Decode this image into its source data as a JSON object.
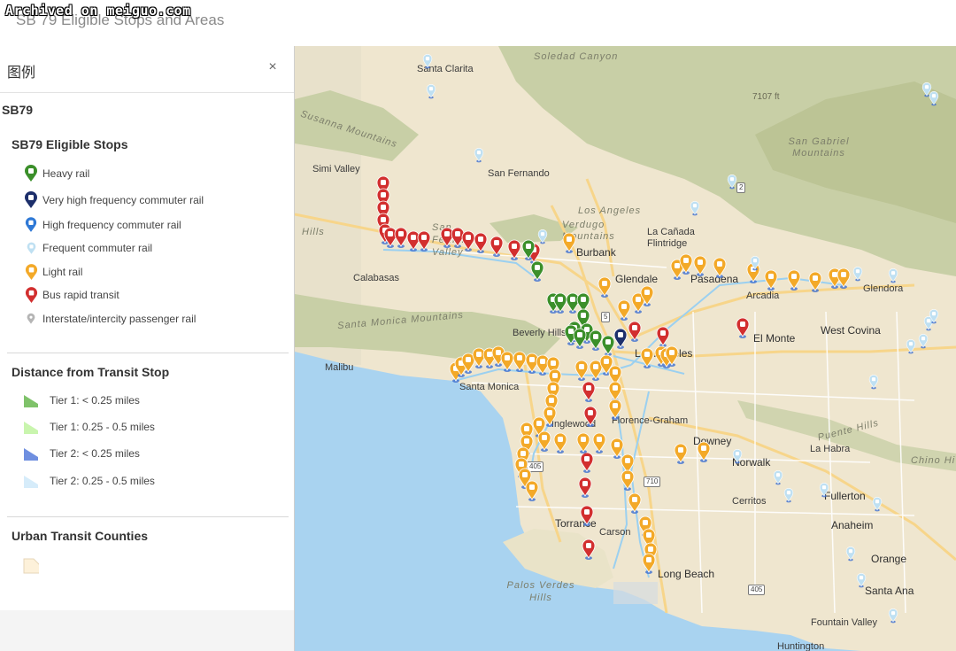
{
  "watermark": "Archived on meiguo.com",
  "app": {
    "title": "SB 79 Eligible Stops and Areas"
  },
  "legend": {
    "title": "图例",
    "close_label": "×",
    "layer_name": "SB79",
    "groups": [
      {
        "title": "SB79 Eligible Stops",
        "items": [
          {
            "label": "Heavy rail",
            "color": "#3b8f2a",
            "icon": "train-icon"
          },
          {
            "label": "Very high frequency commuter rail",
            "color": "#1d2f6b",
            "icon": "train-icon"
          },
          {
            "label": "High frequency commuter rail",
            "color": "#2f79d6",
            "icon": "train-icon"
          },
          {
            "label": "Frequent commuter rail",
            "color": "#bfe0f2",
            "icon": "train-icon"
          },
          {
            "label": "Light rail",
            "color": "#f3a928",
            "icon": "tram-icon"
          },
          {
            "label": "Bus rapid transit",
            "color": "#d22f2f",
            "icon": "bus-icon"
          },
          {
            "label": "Interstate/intercity passenger rail",
            "color": "#b5b5b5",
            "icon": "pin-icon"
          }
        ]
      },
      {
        "title": "Distance from Transit Stop",
        "items": [
          {
            "label": "Tier 1: < 0.25 miles",
            "color": "#7fc26a"
          },
          {
            "label": "Tier 1: 0.25 - 0.5 miles",
            "color": "#c9f5ae"
          },
          {
            "label": "Tier 2: < 0.25 miles",
            "color": "#6f8fe0"
          },
          {
            "label": "Tier 2: 0.25 - 0.5 miles",
            "color": "#d6ecfa"
          }
        ]
      },
      {
        "title": "Urban Transit Counties",
        "items": [
          {
            "label": "",
            "color": "#fdf1da"
          }
        ]
      }
    ]
  },
  "map": {
    "colors": {
      "ocean": "#a9d3f0",
      "land": "#efe6cf",
      "mountain": "#c8cfa6",
      "road": "#ffffff",
      "highway": "#f7d58a"
    },
    "places": [
      {
        "name": "Santa Clarita",
        "kind": "city"
      },
      {
        "name": "Soledad Canyon",
        "kind": "terrain"
      },
      {
        "name": "Susanna Mountains",
        "kind": "terrain"
      },
      {
        "name": "Simi Valley",
        "kind": "city"
      },
      {
        "name": "San Fernando",
        "kind": "city"
      },
      {
        "name": "San Gabriel Mountains",
        "kind": "terrain"
      },
      {
        "name": "Los Angeles",
        "kind": "terrain"
      },
      {
        "name": "San Fernando Valley",
        "kind": "terrain"
      },
      {
        "name": "Verdugo Mountains",
        "kind": "terrain"
      },
      {
        "name": "La Cañada Flintridge",
        "kind": "city"
      },
      {
        "name": "Hills",
        "kind": "terrain"
      },
      {
        "name": "Burbank",
        "kind": "city"
      },
      {
        "name": "Glendale",
        "kind": "city"
      },
      {
        "name": "Pasadena",
        "kind": "city"
      },
      {
        "name": "Arcadia",
        "kind": "city"
      },
      {
        "name": "Glendora",
        "kind": "city"
      },
      {
        "name": "Calabasas",
        "kind": "city"
      },
      {
        "name": "Santa Monica Mountains",
        "kind": "terrain"
      },
      {
        "name": "Beverly Hills",
        "kind": "city"
      },
      {
        "name": "Los Angeles",
        "kind": "city"
      },
      {
        "name": "El Monte",
        "kind": "city"
      },
      {
        "name": "West Covina",
        "kind": "city"
      },
      {
        "name": "Malibu",
        "kind": "city"
      },
      {
        "name": "Santa Monica",
        "kind": "city"
      },
      {
        "name": "Inglewood",
        "kind": "city"
      },
      {
        "name": "Florence-Graham",
        "kind": "city"
      },
      {
        "name": "Downey",
        "kind": "city"
      },
      {
        "name": "Norwalk",
        "kind": "city"
      },
      {
        "name": "La Habra",
        "kind": "city"
      },
      {
        "name": "Puente Hills",
        "kind": "terrain"
      },
      {
        "name": "Chino Hi",
        "kind": "terrain"
      },
      {
        "name": "Fullerton",
        "kind": "city"
      },
      {
        "name": "Cerritos",
        "kind": "city"
      },
      {
        "name": "Anaheim",
        "kind": "city"
      },
      {
        "name": "Torrance",
        "kind": "city"
      },
      {
        "name": "Carson",
        "kind": "city"
      },
      {
        "name": "Orange",
        "kind": "city"
      },
      {
        "name": "Long Beach",
        "kind": "city"
      },
      {
        "name": "Palos Verdes Hills",
        "kind": "terrain"
      },
      {
        "name": "Santa Ana",
        "kind": "city"
      },
      {
        "name": "Fountain Valley",
        "kind": "city"
      },
      {
        "name": "Huntington",
        "kind": "city"
      }
    ],
    "route_shields": [
      "2",
      "5",
      "405",
      "710",
      "405"
    ],
    "elevation_labels": [
      "7107 ft"
    ]
  }
}
